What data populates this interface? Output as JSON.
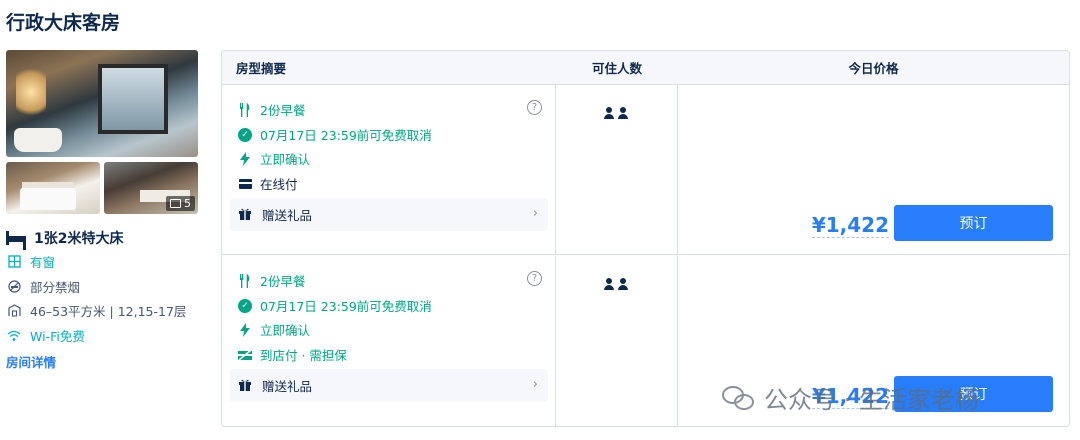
{
  "room_title": "行政大床客房",
  "photos": {
    "count": "5"
  },
  "bed": "1张2米特大床",
  "features": [
    {
      "icon": "window-icon",
      "text": "有窗",
      "highlight": true
    },
    {
      "icon": "no-smoking-icon",
      "text": "部分禁烟",
      "highlight": false
    },
    {
      "icon": "area-icon",
      "text": "46–53平方米 | 12,15-17层",
      "highlight": false
    },
    {
      "icon": "wifi-icon",
      "text": "Wi-Fi免费",
      "highlight": true
    }
  ],
  "room_detail_link": "房间详情",
  "table": {
    "headers": [
      "房型摘要",
      "可住人数",
      "今日价格"
    ]
  },
  "offers": [
    {
      "breakfast": "2份早餐",
      "cancel": "07月17日 23:59前可免费取消",
      "confirm": "立即确认",
      "payment": "在线付",
      "gift": "赠送礼品",
      "price": "¥1,422",
      "book": "预订"
    },
    {
      "breakfast": "2份早餐",
      "cancel": "07月17日 23:59前可免费取消",
      "confirm": "立即确认",
      "payment": "到店付 · 需担保",
      "gift": "赠送礼品",
      "price": "¥1,422",
      "book": "预订"
    }
  ],
  "watermark": "公众号 · 生活家老杨",
  "colors": {
    "accent": "#287dfa",
    "teal": "#00a588",
    "text": "#0f294d"
  }
}
